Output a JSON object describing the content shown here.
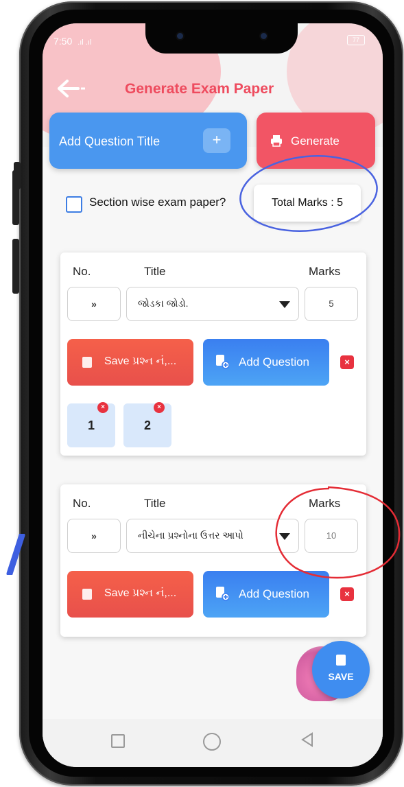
{
  "status_bar": {
    "time": "7:50",
    "signal": ".ıl .ıl",
    "battery": "77"
  },
  "header": {
    "back_icon": "back-arrow-icon",
    "title": "Generate Exam Paper"
  },
  "actions": {
    "add_title_label": "Add Question Title",
    "add_title_icon": "+",
    "generate_label": "Generate"
  },
  "options": {
    "section_wise_label": "Section wise exam paper?",
    "section_wise_checked": false,
    "total_marks": "Total Marks : 5"
  },
  "sections": [
    {
      "col_no": "No.",
      "col_title": "Title",
      "col_marks": "Marks",
      "number_icon": "»",
      "title_value": "જોડકા જોડો.",
      "marks_value": "5",
      "save_label": "Save પ્રશ્ન નં,...",
      "add_question_label": "Add Question",
      "remove_label": "×",
      "questions": [
        "1",
        "2"
      ]
    },
    {
      "col_no": "No.",
      "col_title": "Title",
      "col_marks": "Marks",
      "number_icon": "»",
      "title_value": "નીચેના પ્રશ્નોના ઉત્તર આપો",
      "marks_value": "10",
      "save_label": "Save પ્રશ્ન નં,...",
      "add_question_label": "Add Question",
      "remove_label": "×",
      "questions": []
    }
  ],
  "fab": {
    "label": "SAVE"
  },
  "colors": {
    "primary_blue": "#4a97ef",
    "accent_red": "#f25565",
    "title_red": "#ee4b5e"
  }
}
